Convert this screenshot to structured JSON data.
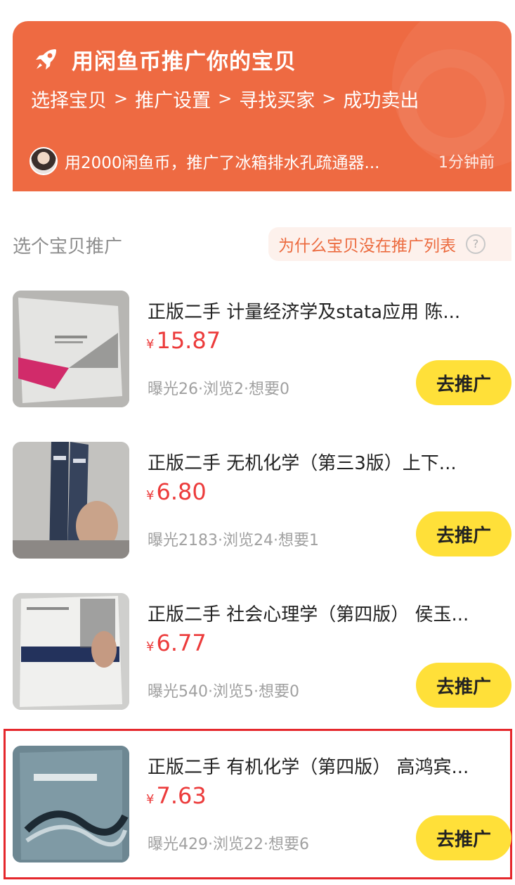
{
  "banner": {
    "title": "用闲鱼币推广你的宝贝",
    "steps": [
      "选择宝贝",
      "推广设置",
      "寻找买家",
      "成功卖出"
    ],
    "promo_text": "用2000闲鱼币，推广了冰箱排水孔疏通器...",
    "promo_time": "1分钟前",
    "bg_color": "#ee6a42"
  },
  "section": {
    "title": "选个宝贝推广",
    "why_link": "为什么宝贝没在推广列表",
    "help_icon": "?"
  },
  "items": [
    {
      "title": "正版二手 计量经济学及stata应用 陈...",
      "currency": "¥",
      "price": "15.87",
      "stats": "曝光26·浏览2·想要0",
      "button": "去推广"
    },
    {
      "title": "正版二手 无机化学（第三3版）上下...",
      "currency": "¥",
      "price": "6.80",
      "stats": "曝光2183·浏览24·想要1",
      "button": "去推广"
    },
    {
      "title": "正版二手 社会心理学（第四版） 侯玉...",
      "currency": "¥",
      "price": "6.77",
      "stats": "曝光540·浏览5·想要0",
      "button": "去推广"
    },
    {
      "title": "正版二手 有机化学（第四版） 高鸿宾...",
      "currency": "¥",
      "price": "7.63",
      "stats": "曝光429·浏览22·想要6",
      "button": "去推广"
    }
  ],
  "colors": {
    "accent": "#ee6a42",
    "price": "#ec3b3b",
    "button": "#ffe039",
    "highlight": "#e5272c"
  }
}
